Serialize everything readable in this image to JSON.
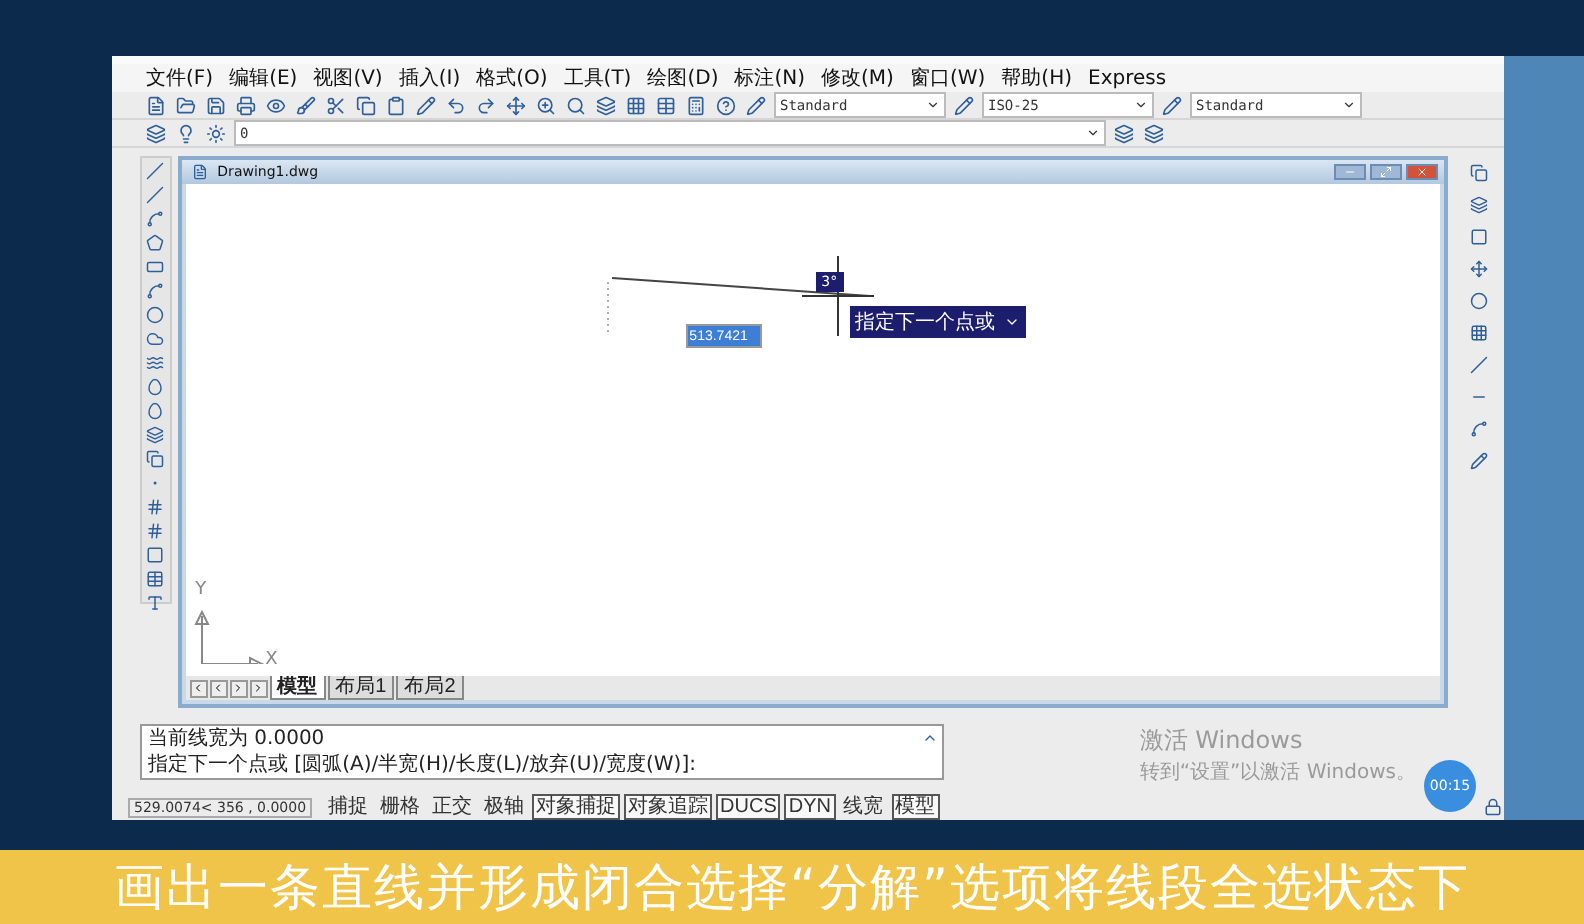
{
  "menu": [
    "文件(F)",
    "编辑(E)",
    "视图(V)",
    "插入(I)",
    "格式(O)",
    "工具(T)",
    "绘图(D)",
    "标注(N)",
    "修改(M)",
    "窗口(W)",
    "帮助(H)",
    "Express"
  ],
  "style_dropdowns": [
    {
      "value": "Standard"
    },
    {
      "value": "ISO-25"
    },
    {
      "value": "Standard"
    }
  ],
  "layer_dropdown": {
    "value": "0"
  },
  "drawing_window": {
    "title": "Drawing1.dwg",
    "angle_tooltip": "3°",
    "length_input": "513.7421",
    "prompt_tooltip": "指定下一个点或",
    "axis_labels": [
      "Y",
      "X"
    ],
    "layout_tabs": [
      {
        "label": "模型",
        "selected": true
      },
      {
        "label": "布局1",
        "selected": false
      },
      {
        "label": "布局2",
        "selected": false
      }
    ]
  },
  "command_lines": [
    "当前线宽为 0.0000",
    "指定下一个点或 [圆弧(A)/半宽(H)/长度(L)/放弃(U)/宽度(W)]:"
  ],
  "status_bar": {
    "coordinates": "529.0074<  356  , 0.0000",
    "toggles": [
      {
        "label": "捕捉",
        "on": false
      },
      {
        "label": "栅格",
        "on": false
      },
      {
        "label": "正交",
        "on": false
      },
      {
        "label": "极轴",
        "on": false
      },
      {
        "label": "对象捕捉",
        "on": true
      },
      {
        "label": "对象追踪",
        "on": true
      },
      {
        "label": "DUCS",
        "on": true
      },
      {
        "label": "DYN",
        "on": true
      },
      {
        "label": "线宽",
        "on": false
      },
      {
        "label": "模型",
        "on": true
      }
    ]
  },
  "activation": {
    "title": "激活 Windows",
    "hint": "转到“设置”以激活 Windows。"
  },
  "timer_badge": "00:15",
  "subtitle": "画出一条直线并形成闭合选择“分解”选项将线段全选状态下"
}
